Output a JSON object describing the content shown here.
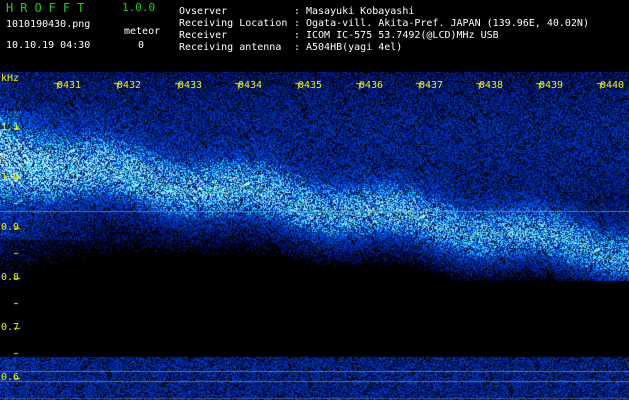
{
  "app": {
    "name": "HROFFT",
    "version": "1.0.0"
  },
  "file": {
    "name": "1010190430.png",
    "datetime": "10.10.19 04:30"
  },
  "meteor": {
    "label": "meteor",
    "count": "0"
  },
  "info": [
    {
      "key": "Ovserver",
      "sep": ":",
      "value": "Masayuki Kobayashi"
    },
    {
      "key": "Receiving Location",
      "sep": ":",
      "value": "Ogata-vill. Akita-Pref. JAPAN (139.96E, 40.02N)"
    },
    {
      "key": "Receiver",
      "sep": ":",
      "value": "ICOM IC-575 53.7492(@LCD)MHz USB"
    },
    {
      "key": "Receiving antenna",
      "sep": ":",
      "value": "A504HB(yagi 4el)"
    }
  ],
  "spectrogram": {
    "y_unit": "kHz",
    "y_ticks": [
      "1.1",
      "1.0",
      "0.9",
      "0.8",
      "0.7",
      "0.6"
    ],
    "x_ticks": [
      "0431",
      "0432",
      "0433",
      "0434",
      "0435",
      "0436",
      "0437",
      "0438",
      "0439",
      "0440"
    ],
    "colors": {
      "background": "#000000",
      "signal": "#2a6cff",
      "peak": "#3fd1b0",
      "tick": "#f0f000"
    }
  }
}
